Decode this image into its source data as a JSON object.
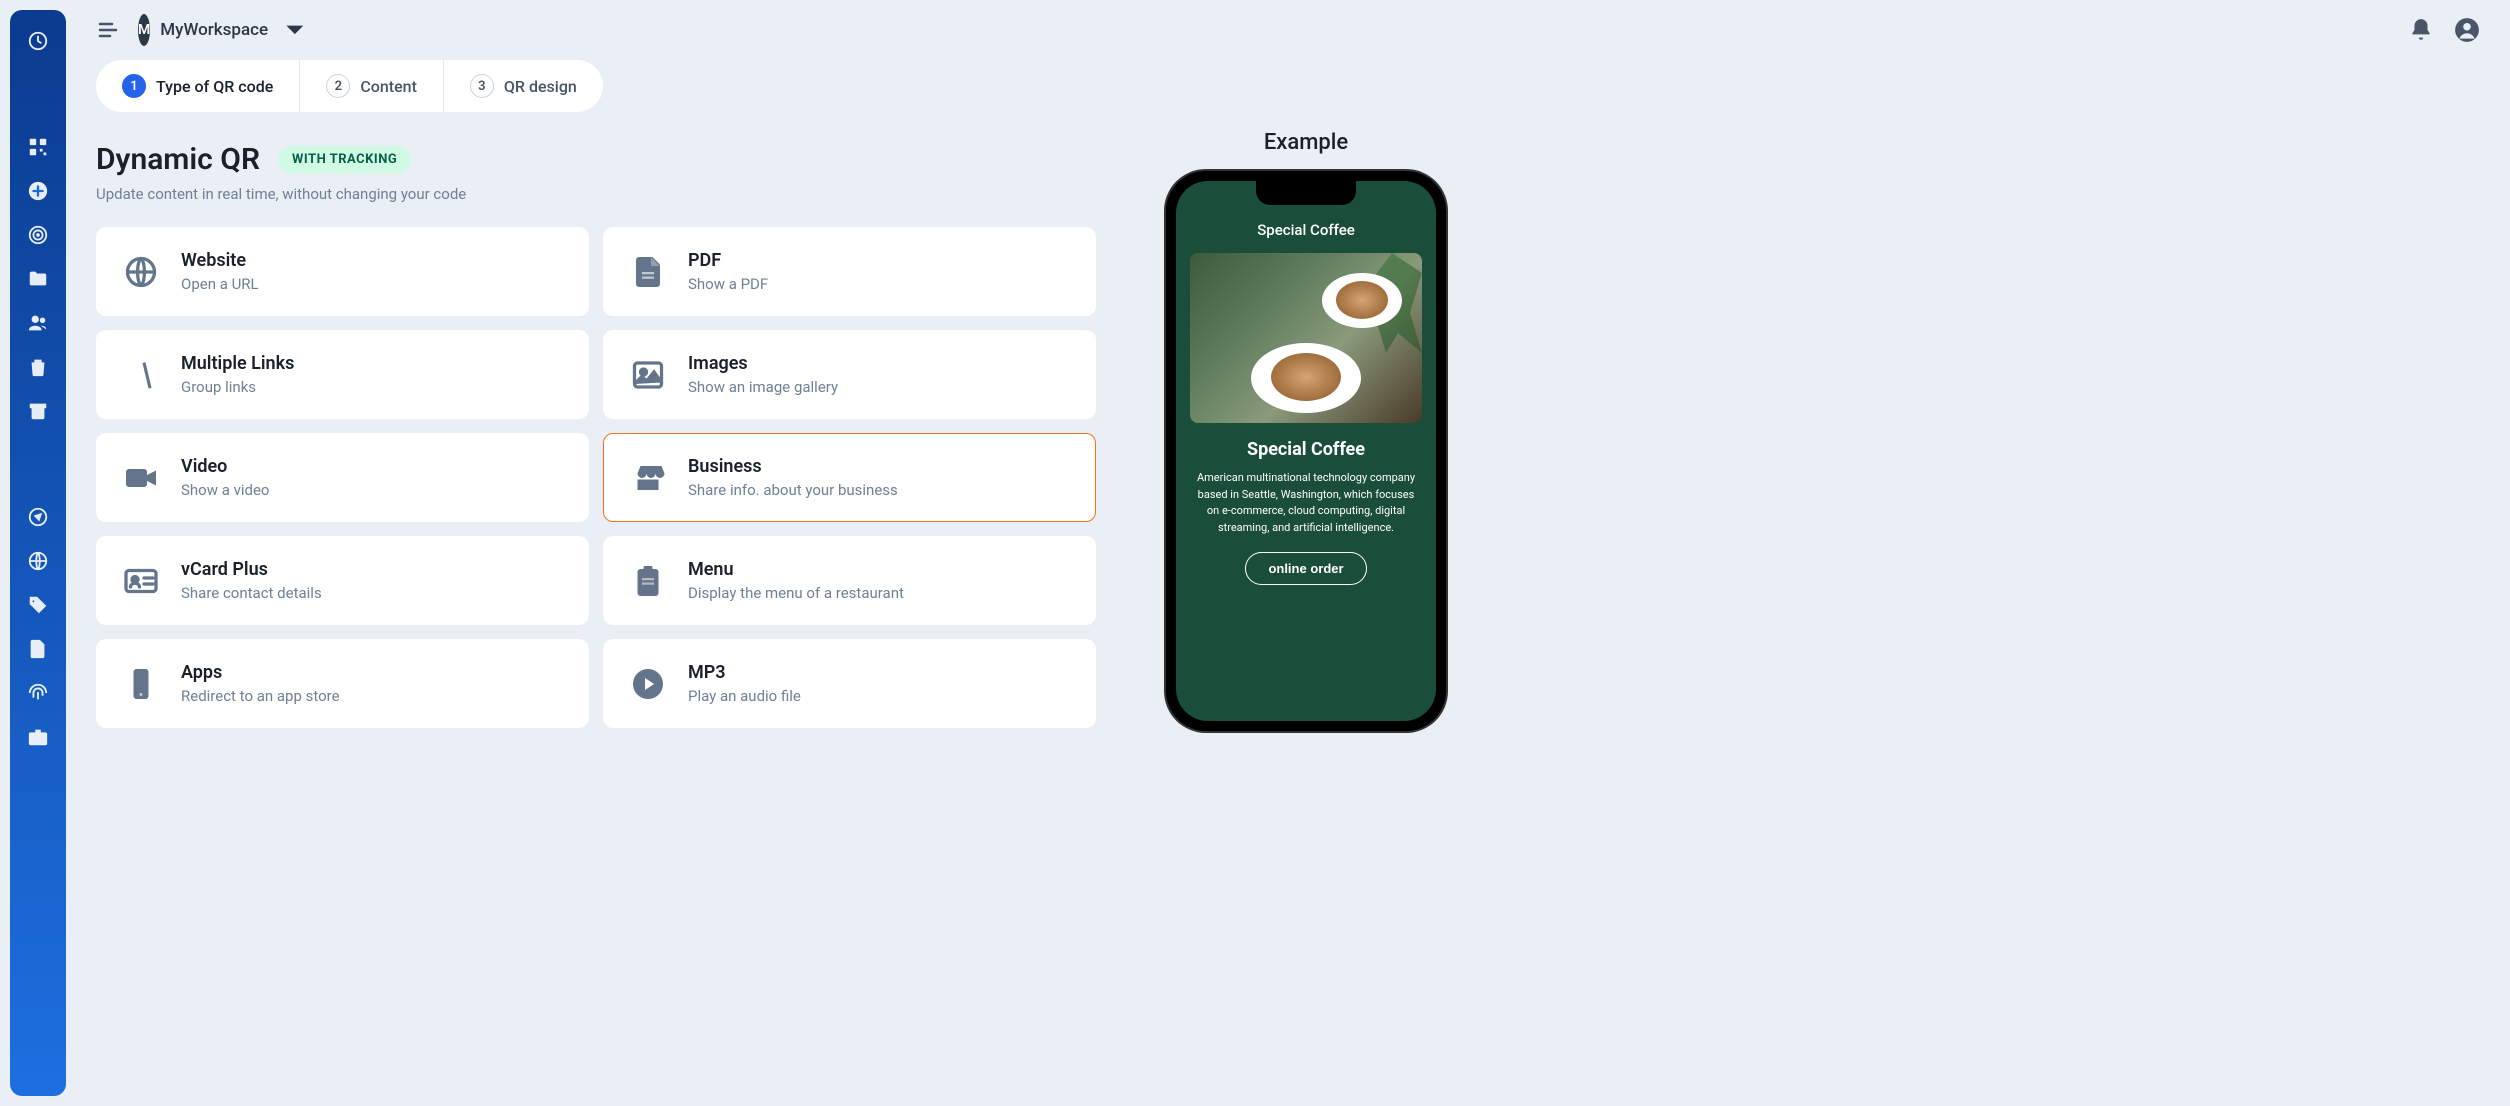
{
  "workspace": {
    "initial": "M",
    "name": "MyWorkspace"
  },
  "steps": [
    {
      "num": "1",
      "label": "Type of QR code",
      "active": true
    },
    {
      "num": "2",
      "label": "Content",
      "active": false
    },
    {
      "num": "3",
      "label": "QR design",
      "active": false
    }
  ],
  "section": {
    "title": "Dynamic QR",
    "badge": "WITH TRACKING",
    "subtitle": "Update content in real time, without changing your code"
  },
  "types": [
    {
      "icon": "globe",
      "title": "Website",
      "desc": "Open a URL",
      "selected": false
    },
    {
      "icon": "file-pdf",
      "title": "PDF",
      "desc": "Show a PDF",
      "selected": false
    },
    {
      "icon": "books",
      "title": "Multiple Links",
      "desc": "Group links",
      "selected": false
    },
    {
      "icon": "image",
      "title": "Images",
      "desc": "Show an image gallery",
      "selected": false
    },
    {
      "icon": "video",
      "title": "Video",
      "desc": "Show a video",
      "selected": false
    },
    {
      "icon": "store",
      "title": "Business",
      "desc": "Share info. about your business",
      "selected": true
    },
    {
      "icon": "id-card",
      "title": "vCard Plus",
      "desc": "Share contact details",
      "selected": false
    },
    {
      "icon": "clipboard",
      "title": "Menu",
      "desc": "Display the menu of a restaurant",
      "selected": false
    },
    {
      "icon": "mobile",
      "title": "Apps",
      "desc": "Redirect to an app store",
      "selected": false
    },
    {
      "icon": "play-circle",
      "title": "MP3",
      "desc": "Play an audio file",
      "selected": false
    }
  ],
  "preview": {
    "label": "Example",
    "header": "Special Coffee",
    "title": "Special Coffee",
    "desc": "American multinational technology company based in Seattle, Washington, which focuses on e-commerce, cloud computing, digital streaming, and artificial intelligence.",
    "button": "online order"
  }
}
